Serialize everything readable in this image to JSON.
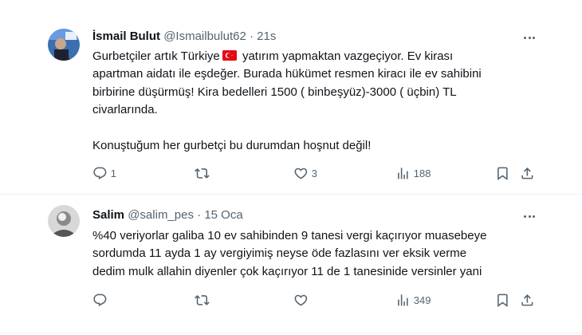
{
  "tweets": [
    {
      "name": "İsmail Bulut",
      "handle": "@Ismailbulut62",
      "separator": "·",
      "time": "21s",
      "text_part1": "Gurbetçiler artık Türkiye",
      "flag_icon": "turkey-flag-emoji",
      "text_part2": " yatırım yapmaktan vazgeçiyor. Ev kirası\napartman aidatı ile eşdeğer. Burada hükümet resmen kiracı ile ev sahibini\nbirbirine düşürmüş! Kira bedelleri 1500 ( binbeşyüz)-3000 ( üçbin) TL\ncivarlarında.\n\nKonuştuğum her gurbetçi bu durumdan hoşnut değil!",
      "replies": "1",
      "retweets": "",
      "likes": "3",
      "views": "188"
    },
    {
      "name": "Salim",
      "handle": "@salim_pes",
      "separator": "·",
      "time": "15 Oca",
      "text": "%40 veriyorlar galiba 10 ev sahibinden 9 tanesi vergi kaçırıyor  muasebeye\nsordumda 11 ayda 1 ay vergiyimiş  neyse öde fazlasını ver eksik verme\ndedim   mulk allahin diyenler çok kaçırıyor 11 de 1 tanesinide versinler yani",
      "replies": "",
      "retweets": "",
      "likes": "",
      "views": "349"
    }
  ],
  "colors": {
    "text": "#0f1419",
    "secondary": "#536471",
    "divider": "#eff3f4",
    "flag_red": "#e30a17"
  }
}
